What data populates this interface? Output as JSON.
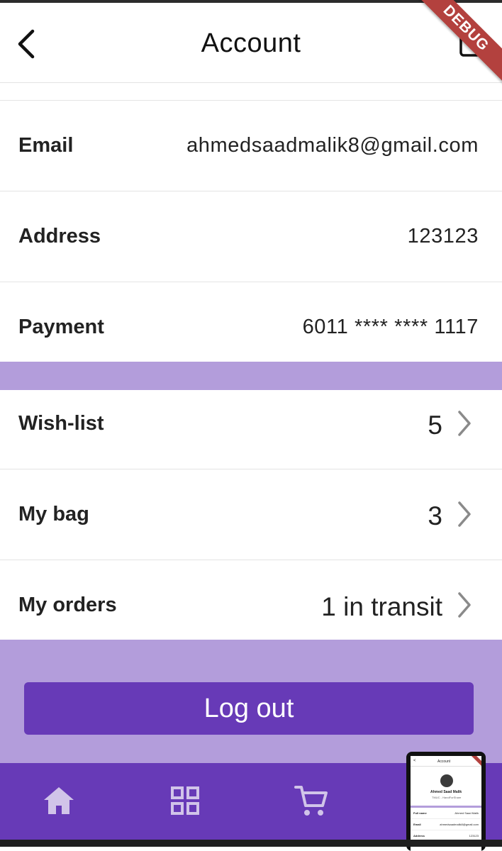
{
  "appbar": {
    "title": "Account",
    "debug_banner": "DEBUG"
  },
  "info_rows": [
    {
      "label": "Email",
      "value": "ahmedsaadmalik8@gmail.com"
    },
    {
      "label": "Address",
      "value": "123123"
    },
    {
      "label": "Payment",
      "value": "6011 **** **** 1117"
    }
  ],
  "nav_rows": [
    {
      "label": "Wish-list",
      "value": "5"
    },
    {
      "label": "My bag",
      "value": "3"
    },
    {
      "label": "My orders",
      "value": "1 in transit"
    }
  ],
  "logout_label": "Log out",
  "bottom_nav": {
    "items": [
      "home-icon",
      "grid-icon",
      "cart-icon"
    ]
  },
  "preview": {
    "title": "Account",
    "name": "Ahmed Saad Malik",
    "subtitle": "TMUC - HandForShare",
    "rows": [
      {
        "label": "Full name",
        "value": "Ahmed Saad Malik"
      },
      {
        "label": "Email",
        "value": "ahmedsaadmalik8@gmail.com"
      },
      {
        "label": "Address",
        "value": "123123"
      }
    ]
  },
  "colors": {
    "accent": "#673ab7",
    "band": "#b39ddb",
    "debug": "#b3413e",
    "icon_inactive": "#d1c4e9"
  }
}
